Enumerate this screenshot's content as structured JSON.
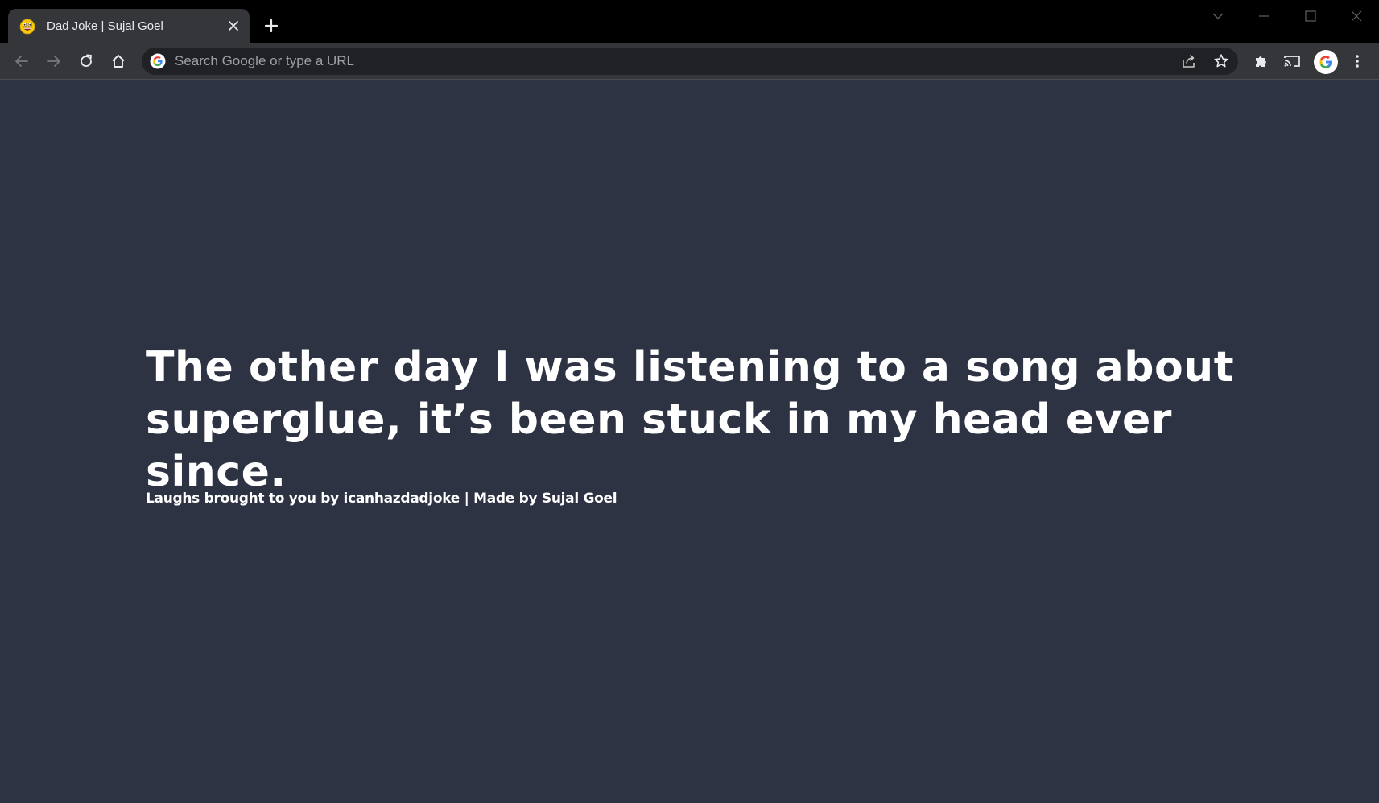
{
  "browser": {
    "tab": {
      "title": "Dad Joke | Sujal Goel",
      "favicon": "grinning-face-emoji"
    },
    "omnibox": {
      "placeholder": "Search Google or type a URL"
    },
    "colors": {
      "titlebar": "#000000",
      "toolbar": "#35363a",
      "omnibox": "#202124",
      "page_background": "#2e3344"
    }
  },
  "page": {
    "joke": "The other day I was listening to a song about superglue, it’s been stuck in my head ever since.",
    "credit": "Laughs brought to you by icanhazdadjoke | Made by Sujal Goel",
    "text_color": "#ffffff"
  }
}
